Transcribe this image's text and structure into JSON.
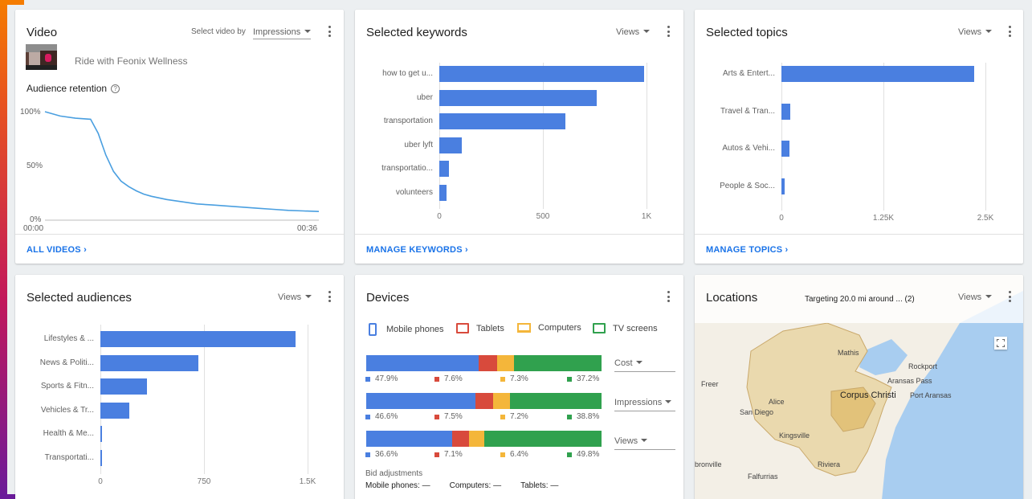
{
  "colors": {
    "bar_blue": "#4a7fe0",
    "line_blue": "#4a9fe0",
    "link_blue": "#1a73e8",
    "mobile": "#4a7fe0",
    "tablets": "#d84a3c",
    "computers": "#f4b63a",
    "tv": "#30a14e",
    "map_water": "#a8cdf0",
    "map_land": "#f3efe6",
    "map_target": "#ead9ae"
  },
  "video_card": {
    "title": "Video",
    "select_by_label": "Select video by",
    "select_value": "Impressions",
    "video_title": "Ride with Feonix Wellness",
    "retention_label": "Audience retention",
    "help_icon": "help-circle-icon",
    "footer_link": "ALL VIDEOS",
    "chart_data": {
      "type": "line",
      "title": "Audience retention",
      "x_tick_labels": [
        "00:00",
        "00:36"
      ],
      "y_tick_labels": [
        "100%",
        "50%",
        "0%"
      ],
      "ylim": [
        0,
        100
      ],
      "xlim": [
        0,
        36
      ],
      "x": [
        0,
        2,
        4,
        6,
        7,
        8,
        9,
        10,
        11,
        12,
        13,
        14,
        16,
        18,
        20,
        22,
        24,
        26,
        28,
        30,
        32,
        34,
        36
      ],
      "y": [
        100,
        96,
        94,
        93,
        80,
        60,
        45,
        36,
        31,
        27,
        24,
        22,
        19,
        17,
        15,
        14,
        13,
        12,
        11,
        10,
        9,
        8.5,
        8
      ]
    }
  },
  "keywords_card": {
    "title": "Selected keywords",
    "metric": "Views",
    "footer_link": "MANAGE KEYWORDS",
    "chart_data": {
      "type": "bar",
      "orientation": "horizontal",
      "categories": [
        "how to get u...",
        "uber",
        "transportation",
        "uber lyft",
        "transportatio...",
        "volunteers"
      ],
      "values": [
        990,
        760,
        610,
        110,
        45,
        35
      ],
      "xlim": [
        0,
        1000
      ],
      "x_ticks": [
        0,
        500,
        1000
      ],
      "x_tick_labels": [
        "0",
        "500",
        "1K"
      ]
    }
  },
  "topics_card": {
    "title": "Selected topics",
    "metric": "Views",
    "footer_link": "MANAGE TOPICS",
    "chart_data": {
      "type": "bar",
      "orientation": "horizontal",
      "categories": [
        "Arts & Entert...",
        "Travel & Tran...",
        "Autos & Vehi...",
        "People & Soc..."
      ],
      "values": [
        2360,
        110,
        100,
        40
      ],
      "xlim": [
        0,
        2500
      ],
      "x_ticks": [
        0,
        1250,
        2500
      ],
      "x_tick_labels": [
        "0",
        "1.25K",
        "2.5K"
      ]
    }
  },
  "audiences_card": {
    "title": "Selected audiences",
    "metric": "Views",
    "chart_data": {
      "type": "bar",
      "orientation": "horizontal",
      "categories": [
        "Lifestyles & ...",
        "News & Politi...",
        "Sports & Fitn...",
        "Vehicles & Tr...",
        "Health & Me...",
        "Transportati..."
      ],
      "values": [
        1410,
        710,
        340,
        210,
        10,
        6
      ],
      "xlim": [
        0,
        1500
      ],
      "x_ticks": [
        0,
        750,
        1500
      ],
      "x_tick_labels": [
        "0",
        "750",
        "1.5K"
      ]
    }
  },
  "devices_card": {
    "title": "Devices",
    "legend": [
      {
        "label": "Mobile phones",
        "icon": "phone-icon"
      },
      {
        "label": "Tablets",
        "icon": "tablet-icon"
      },
      {
        "label": "Computers",
        "icon": "laptop-icon"
      },
      {
        "label": "TV screens",
        "icon": "tv-icon"
      }
    ],
    "chart_data": {
      "type": "bar",
      "orientation": "horizontal-stacked-100",
      "categories": [
        "Cost",
        "Impressions",
        "Views"
      ],
      "series": [
        {
          "name": "Mobile phones",
          "values": [
            47.9,
            46.6,
            36.6
          ]
        },
        {
          "name": "Tablets",
          "values": [
            7.6,
            7.5,
            7.1
          ]
        },
        {
          "name": "Computers",
          "values": [
            7.3,
            7.2,
            6.4
          ]
        },
        {
          "name": "TV screens",
          "values": [
            37.2,
            38.8,
            49.8
          ]
        }
      ],
      "value_labels": [
        [
          "47.9%",
          "7.6%",
          "7.3%",
          "37.2%"
        ],
        [
          "46.6%",
          "7.5%",
          "7.2%",
          "38.8%"
        ],
        [
          "36.6%",
          "7.1%",
          "6.4%",
          "49.8%"
        ]
      ]
    },
    "bid_label": "Bid adjustments",
    "bid": [
      {
        "label": "Mobile phones:",
        "value": "—"
      },
      {
        "label": "Computers:",
        "value": "—"
      },
      {
        "label": "Tablets:",
        "value": "—"
      }
    ]
  },
  "locations_card": {
    "title": "Locations",
    "targeting": "Targeting 20.0 mi around ... (2)",
    "metric": "Views",
    "fullscreen_icon": "fullscreen-icon",
    "map_labels": [
      "Mathis",
      "Rockport",
      "Aransas Pass",
      "Freer",
      "Alice",
      "San Diego",
      "Corpus Christi",
      "Port Aransas",
      "Kingsville",
      "bronville",
      "Riviera",
      "Falfurrias"
    ]
  }
}
